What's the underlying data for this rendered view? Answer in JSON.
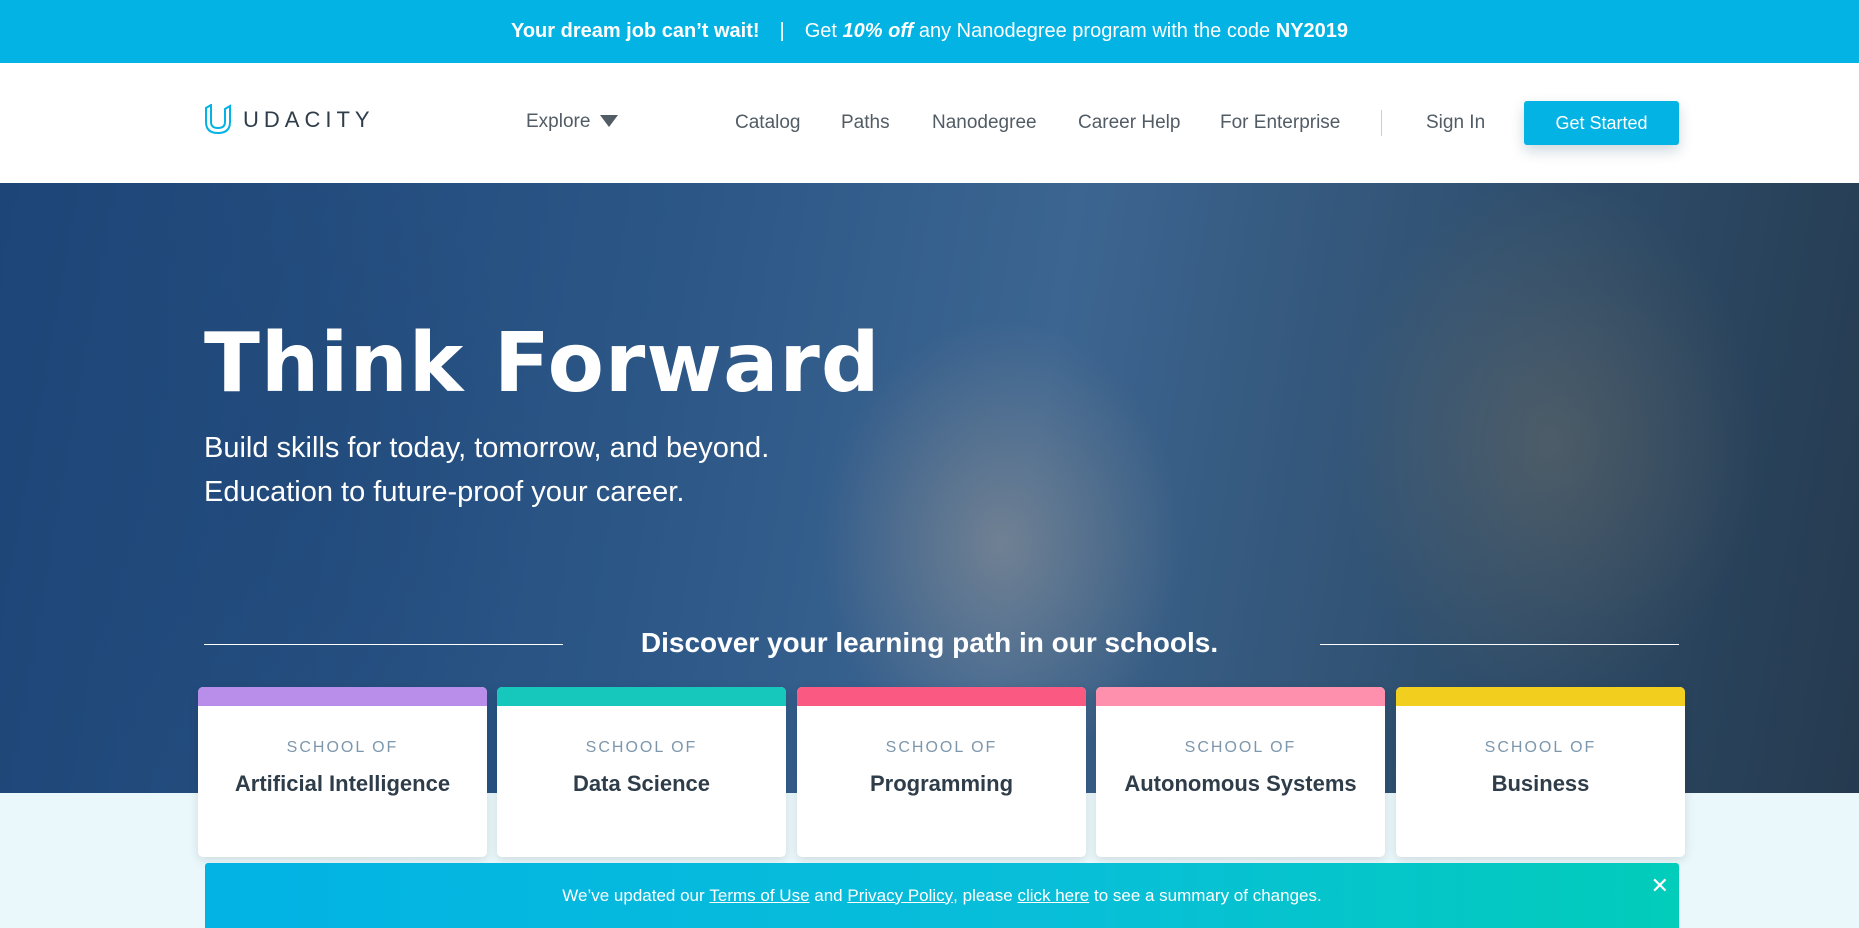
{
  "promo": {
    "lead": "Your dream job can’t wait!",
    "separator": "|",
    "text_pre": "Get ",
    "discount": "10% off",
    "text_mid": " any Nanodegree program with the code ",
    "code": "NY2019"
  },
  "nav": {
    "logo_text": "UDACITY",
    "explore": "Explore",
    "links": [
      "Catalog",
      "Paths",
      "Nanodegree",
      "Career Help",
      "For Enterprise"
    ],
    "sign_in": "Sign In",
    "get_started": "Get Started"
  },
  "hero": {
    "title": "Think Forward",
    "subtitle_line1": "Build skills for today, tomorrow, and beyond.",
    "subtitle_line2": "Education to future-proof your career.",
    "discover": "Discover your learning path in our schools."
  },
  "schools": [
    {
      "kicker": "SCHOOL OF",
      "name": "Artificial Intelligence",
      "color": "#b98eea"
    },
    {
      "kicker": "SCHOOL OF",
      "name": "Data Science",
      "color": "#15c8bb"
    },
    {
      "kicker": "SCHOOL OF",
      "name": "Programming",
      "color": "#fa5a82"
    },
    {
      "kicker": "SCHOOL OF",
      "name": "Autonomous Systems",
      "color": "#fe8fad"
    },
    {
      "kicker": "SCHOOL OF",
      "name": "Business",
      "color": "#f2cf1f"
    }
  ],
  "notice": {
    "t1": "We’ve updated our ",
    "terms": "Terms of Use",
    "t2": " and ",
    "privacy": "Privacy Policy",
    "t3": ", please ",
    "click": "click here",
    "t4": " to see a summary of changes.",
    "close": "✕"
  },
  "colors": {
    "brand": "#02b3e4",
    "text_dark": "#2e3d49"
  }
}
